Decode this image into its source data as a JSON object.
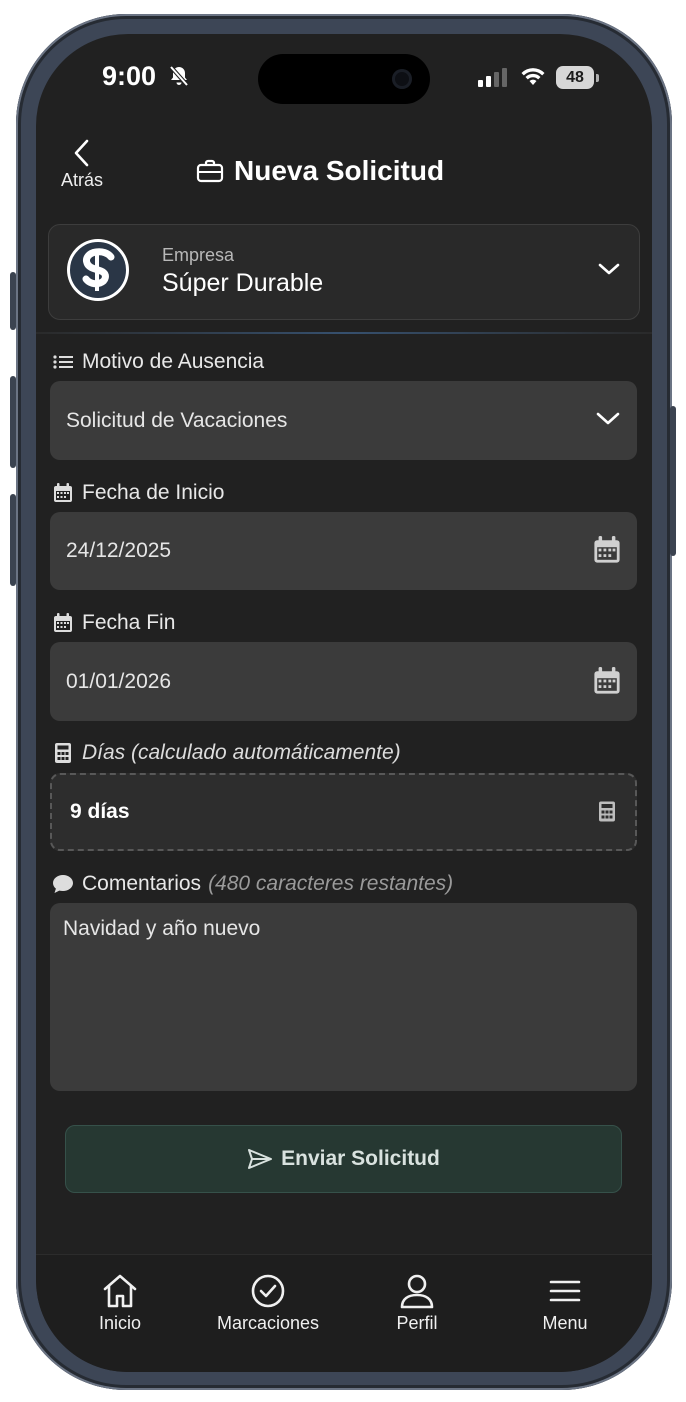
{
  "status_bar": {
    "time": "9:00",
    "battery": "48"
  },
  "header": {
    "back_label": "Atrás",
    "title": "Nueva Solicitud"
  },
  "company": {
    "label": "Empresa",
    "name": "Súper Durable"
  },
  "form": {
    "motivo": {
      "label": "Motivo de Ausencia",
      "value": "Solicitud de Vacaciones"
    },
    "fecha_inicio": {
      "label": "Fecha de Inicio",
      "value": "24/12/2025"
    },
    "fecha_fin": {
      "label": "Fecha Fin",
      "value": "01/01/2026"
    },
    "dias": {
      "label": "Días (calculado automáticamente)",
      "value": "9 días"
    },
    "comentarios": {
      "label": "Comentarios",
      "remaining": "(480 caracteres restantes)",
      "value": "Navidad y año nuevo"
    },
    "submit_label": "Enviar Solicitud"
  },
  "tabs": [
    {
      "label": "Inicio",
      "icon": "home-icon"
    },
    {
      "label": "Marcaciones",
      "icon": "check-circle-icon"
    },
    {
      "label": "Perfil",
      "icon": "user-icon"
    },
    {
      "label": "Menu",
      "icon": "hamburger-icon"
    }
  ],
  "colors": {
    "background": "#212121",
    "field": "#3b3b3b",
    "submit_bg": "#263832",
    "accent_line": "#36506e"
  }
}
